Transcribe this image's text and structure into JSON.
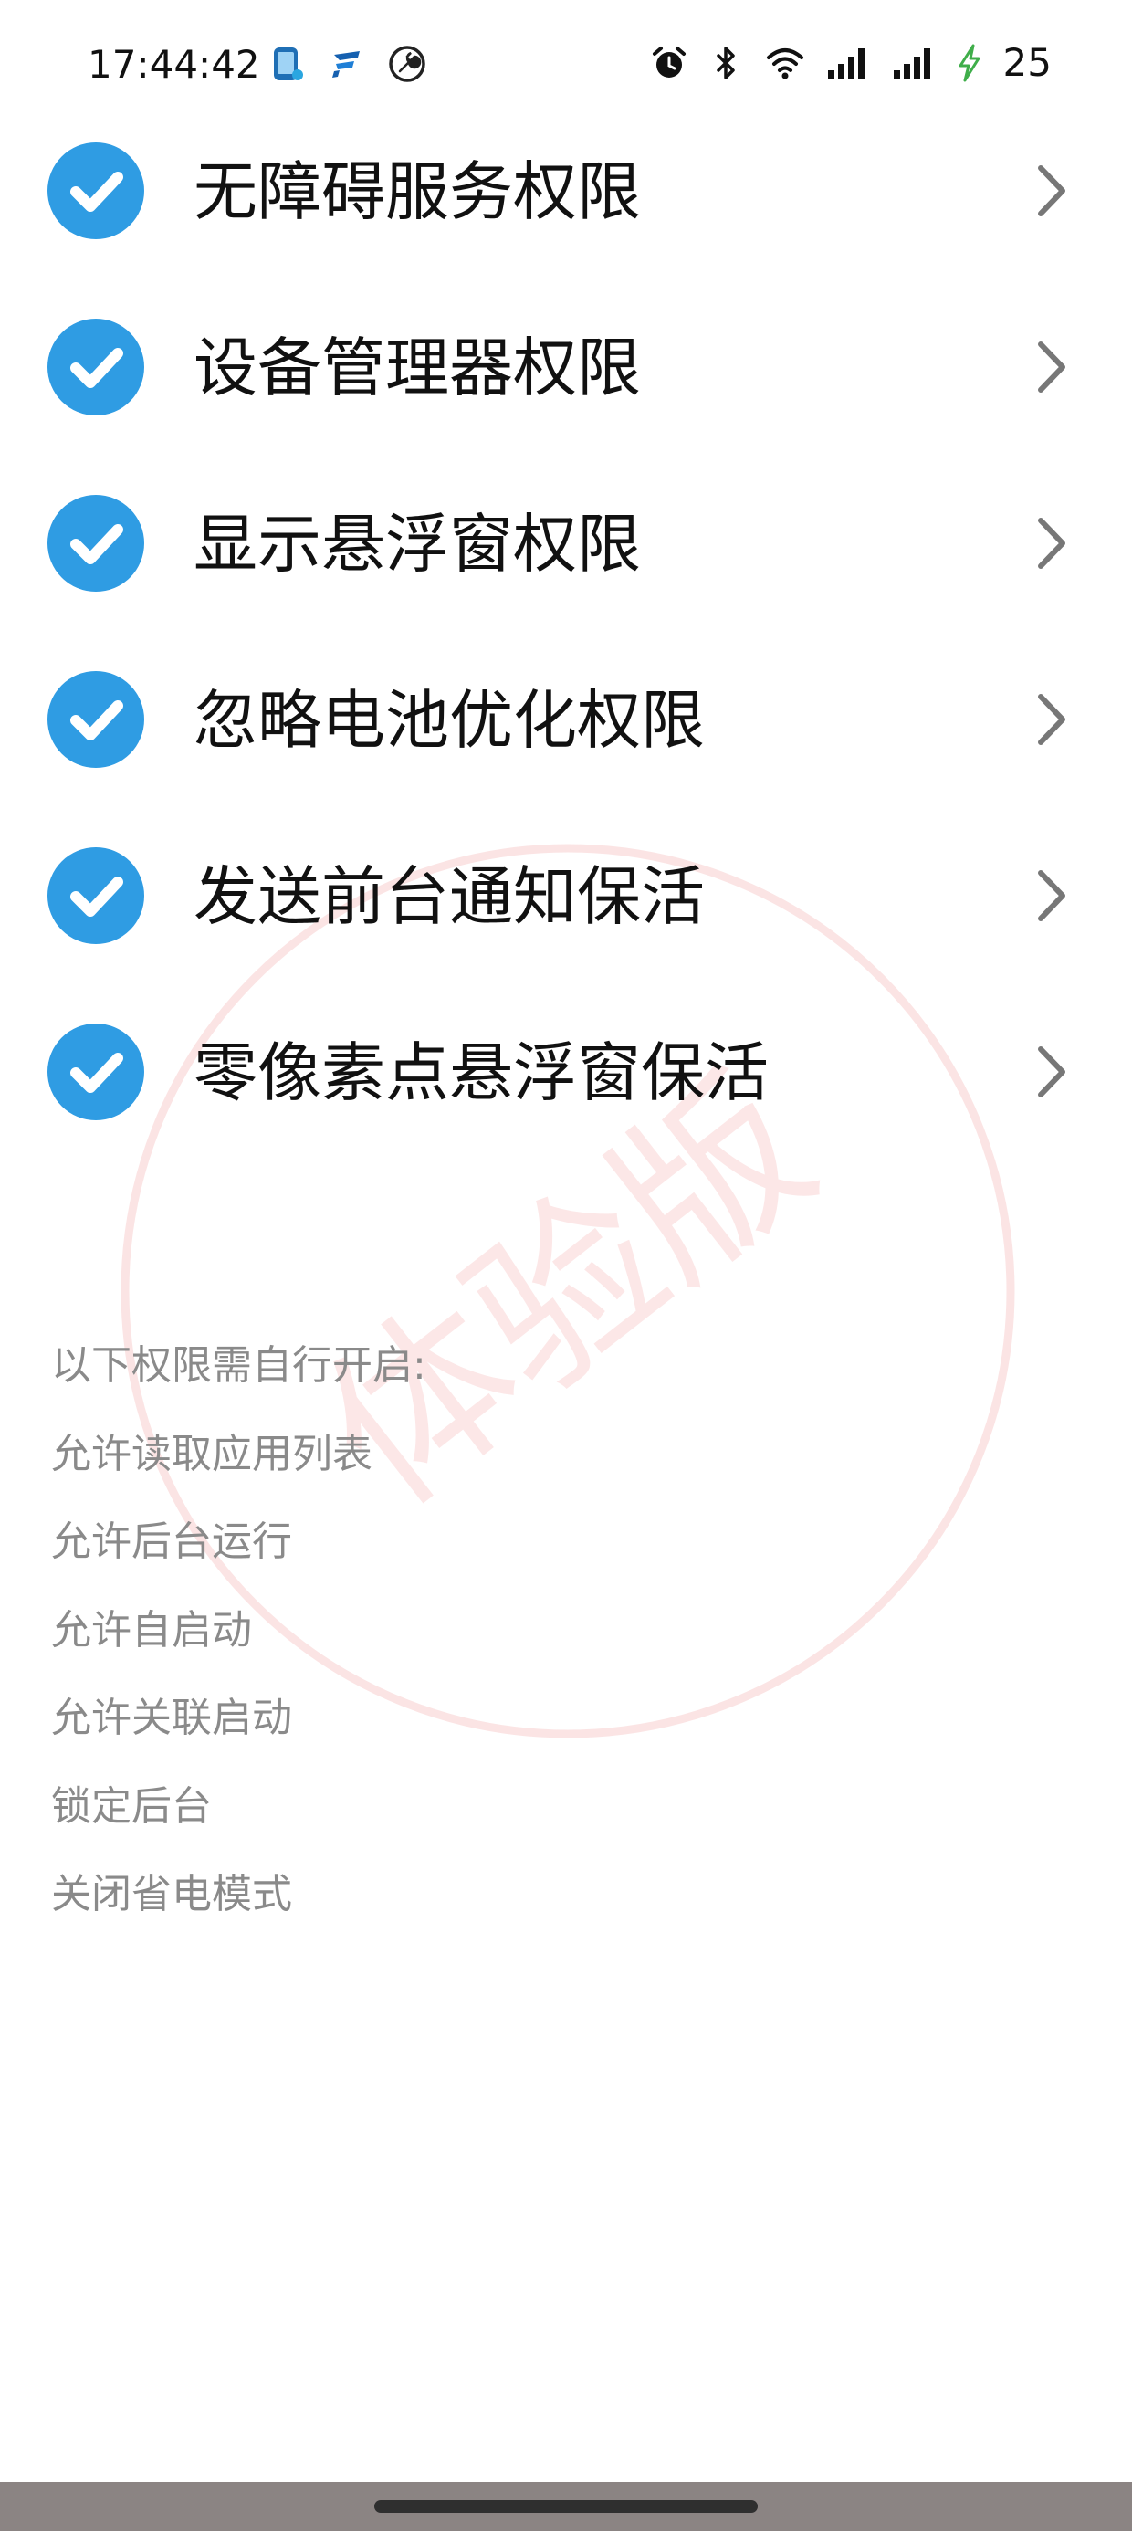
{
  "status_bar": {
    "time": "17:44:42",
    "battery_level": "25",
    "left_icons": [
      "phone-app-icon",
      "f-app-icon",
      "wrench-app-icon"
    ],
    "right_icons": [
      "alarm-icon",
      "bluetooth-icon",
      "wifi-icon",
      "signal-icon",
      "signal-icon",
      "charging-icon"
    ]
  },
  "permissions": [
    {
      "label": "无障碍服务权限",
      "checked": true
    },
    {
      "label": "设备管理器权限",
      "checked": true
    },
    {
      "label": "显示悬浮窗权限",
      "checked": true
    },
    {
      "label": "忽略电池优化权限",
      "checked": true
    },
    {
      "label": "发送前台通知保活",
      "checked": true
    },
    {
      "label": "零像素点悬浮窗保活",
      "checked": true
    }
  ],
  "manual_notes": {
    "header": "以下权限需自行开启:",
    "items": [
      "允许读取应用列表",
      "允许后台运行",
      "允许自启动",
      "允许关联启动",
      "锁定后台",
      "关闭省电模式"
    ]
  },
  "watermark": {
    "text": "体验版"
  },
  "colors": {
    "check_blue": "#2f9ce3",
    "label_text": "#111111",
    "note_text": "#8a8a8a",
    "chevron": "#777777",
    "watermark": "#ec7878",
    "nav_bar": "#8b8483"
  }
}
